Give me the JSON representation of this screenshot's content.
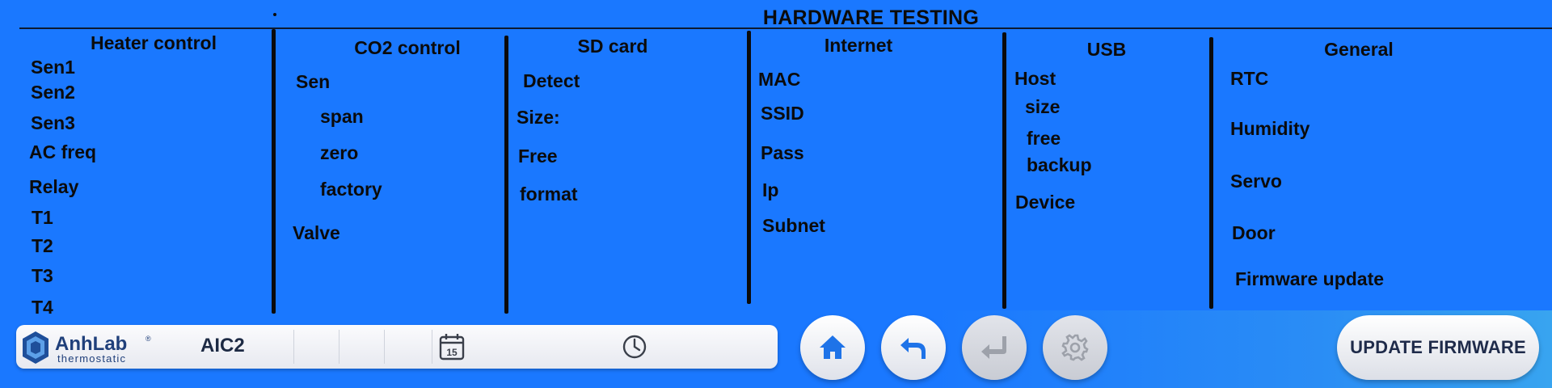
{
  "page": {
    "title": "HARDWARE TESTING"
  },
  "columns": [
    {
      "title": "Heater control",
      "items": [
        "Sen1",
        "Sen2",
        "Sen3",
        "AC freq",
        "Relay",
        "T1",
        "T2",
        "T3",
        "T4"
      ]
    },
    {
      "title": "CO2 control",
      "items": [
        "Sen",
        "span",
        "zero",
        "factory",
        "Valve"
      ]
    },
    {
      "title": "SD card",
      "items": [
        "Detect",
        "Size:",
        "Free",
        "format"
      ]
    },
    {
      "title": "Internet",
      "items": [
        "MAC",
        "SSID",
        "Pass",
        "Ip",
        "Subnet"
      ]
    },
    {
      "title": "USB",
      "items": [
        "Host",
        "size",
        "free",
        "backup",
        "Device"
      ]
    },
    {
      "title": "General",
      "items": [
        "RTC",
        "Humidity",
        "Servo",
        "Door",
        "Firmware update"
      ]
    }
  ],
  "bottom_bar": {
    "logo": {
      "brand": "AnhLab",
      "registered": "®",
      "subtitle": "thermostatic"
    },
    "device_name": "AIC2",
    "icons": {
      "calendar": "calendar-icon",
      "clock": "clock-icon",
      "calendar_day": "15"
    }
  },
  "nav": {
    "home": {
      "icon": "home-icon"
    },
    "back": {
      "icon": "back-arrow-icon"
    },
    "enter": {
      "icon": "enter-return-icon",
      "disabled": true
    },
    "settings": {
      "icon": "gear-icon",
      "disabled": true
    }
  },
  "update_firmware": {
    "label": "UPDATE FIRMWARE"
  },
  "colors": {
    "background": "#1a78ff",
    "text": "#0b0b0b",
    "button_text": "#1f2b4a"
  }
}
